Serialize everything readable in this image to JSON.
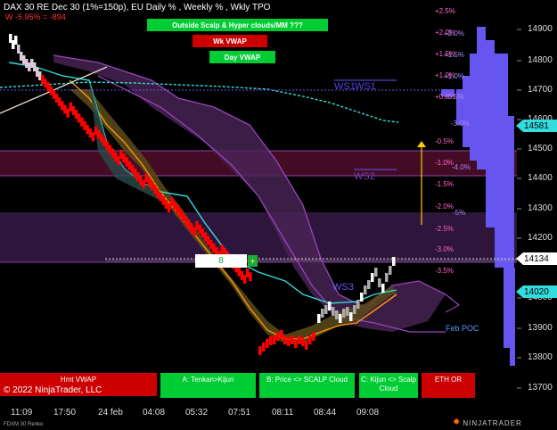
{
  "header": {
    "title": "DAX 30 RE Dec 30 (1%=150p), EU Daily % , Weekly % , Wkly TPO",
    "change": "W -5.95% = -894"
  },
  "top_buttons": {
    "clouds": "Outside Scalp & Hyper clouds/MM ???",
    "wk_vwap": "Wk VWAP",
    "day_vwap": "Day VWAP"
  },
  "bottom_buttons": {
    "hmt_vwap": "Hmt VWAP",
    "tenkan": "A: Tenkan>Kijun",
    "price_scalp": "B: Price <> SCALP Cloud",
    "kijun_scalp": "C: Kijun <> Scalp Cloud",
    "eth_or": "ETH OR"
  },
  "copyright": "© 2022 NinjaTrader, LLC",
  "instrument_footer": "FDXM 30 Renko",
  "brand": "NINJATRADER",
  "order_entry": {
    "quantity": "8",
    "submit_symbol": "+"
  },
  "levels": {
    "ws1": "WS1",
    "ws1_echo": "WS1",
    "ws2": "WS2",
    "feb_poc": "Feb POC",
    "ws3": "WS3"
  },
  "price_tags": {
    "last": "14134",
    "upper": "14581",
    "lower": "14020"
  },
  "price_axis": [
    "14900",
    "14800",
    "14700",
    "14600",
    "14500",
    "14400",
    "14300",
    "14200",
    "14100",
    "14000",
    "13900",
    "13800",
    "13700"
  ],
  "pct_labels_left": [
    "+2.5%",
    "+2.0%",
    "+1.5%",
    "+1.0%",
    "+0.5%",
    "-0.5%",
    "-1.0%",
    "-1.5%",
    "-2.0%",
    "-2.5%",
    "-3.0%",
    "-3.5%"
  ],
  "pct_labels_right": [
    "+2.0%",
    "+1.5%",
    "+1.0%",
    "+0.5%",
    "-3.0%",
    "-4.0%",
    "-5%"
  ],
  "time_axis": [
    "11:09",
    "17:50",
    "24 feb",
    "04:08",
    "05:32",
    "07:51",
    "08:11",
    "08:44",
    "09:08"
  ],
  "colors": {
    "background": "#000000",
    "bull_bar": "#ffffff",
    "bear_bar": "#ff0000",
    "top_green": "#00cc33",
    "top_red": "#cc0000",
    "cloud_purple": "#7d3fa6",
    "kijun_orange": "#ff9900",
    "tenkan_cyan": "#33dddd",
    "tpo_blue": "#6655ee",
    "pct_text": "#ff66cc"
  }
}
